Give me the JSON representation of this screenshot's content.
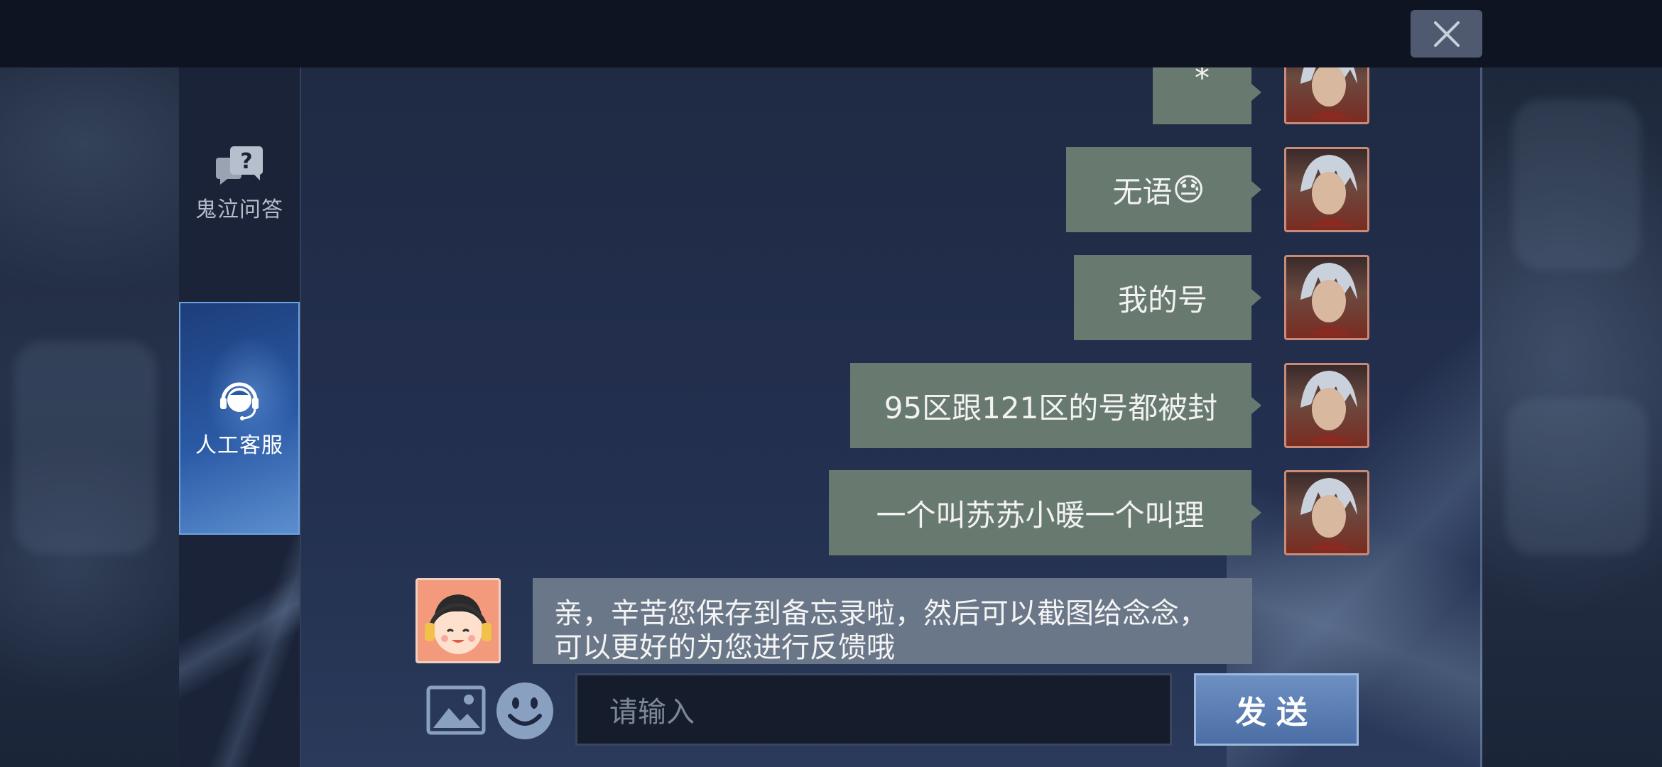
{
  "sidebar": {
    "items": [
      {
        "label": "鬼泣问答",
        "icon": "qa-bubble-icon",
        "active": false
      },
      {
        "label": "人工客服",
        "icon": "headset-agent-icon",
        "active": true
      }
    ]
  },
  "chat": {
    "user_messages": [
      {
        "text": "*"
      },
      {
        "text": "无语",
        "emoji": "😓"
      },
      {
        "text": "我的号"
      },
      {
        "text": "95区跟121区的号都被封"
      },
      {
        "text": "一个叫苏苏小暖一个叫理"
      }
    ],
    "bot_message": {
      "text": "亲，辛苦您保存到备忘录啦，然后可以截图给念念，可以更好的为您进行反馈哦"
    }
  },
  "composer": {
    "placeholder": "请输入",
    "send_label": "发送",
    "image_icon": "image-icon",
    "emoji_icon": "emoji-icon"
  },
  "colors": {
    "user_bubble": "#687a70",
    "bot_bubble": "#6a7788",
    "send_button": "#5a7db5"
  }
}
